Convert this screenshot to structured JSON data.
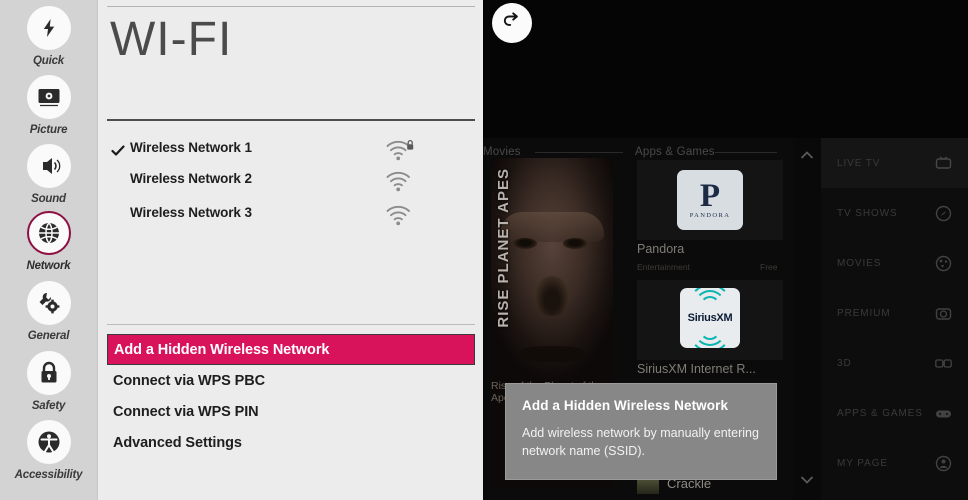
{
  "tv": {
    "back_button": {
      "icon": "back-arrow-icon"
    },
    "movies": {
      "heading": "Movies",
      "poster_title": "RISE PLANET APES",
      "poster_caption": "Rise of the Planet of the Apes"
    },
    "apps": {
      "heading": "Apps & Games",
      "items": [
        {
          "name": "Pandora",
          "logo_letter": "P",
          "logo_word": "PANDORA",
          "category": "Entertainment",
          "price": "Free"
        },
        {
          "name": "SiriusXM Internet R...",
          "logo_word": "SiriusXM",
          "category": "",
          "price": ""
        },
        {
          "name": "Crackle",
          "category": "",
          "price": ""
        }
      ],
      "scroll_up_icon": "chevron-up-icon",
      "scroll_down_icon": "chevron-down-icon"
    },
    "menu": [
      {
        "label": "LIVE TV",
        "icon": "tv-icon"
      },
      {
        "label": "TV SHOWS",
        "icon": "compass-icon"
      },
      {
        "label": "MOVIES",
        "icon": "film-reel-icon"
      },
      {
        "label": "PREMIUM",
        "icon": "camera-icon"
      },
      {
        "label": "3D",
        "icon": "glasses-3d-icon"
      },
      {
        "label": "APPS & GAMES",
        "icon": "gamepad-icon"
      },
      {
        "label": "MY PAGE",
        "icon": "person-icon"
      }
    ]
  },
  "tooltip": {
    "title": "Add a Hidden Wireless Network",
    "body": "Add wireless network by manually entering network name (SSID)."
  },
  "settings": {
    "sidebar": {
      "items": [
        {
          "label": "Quick",
          "icon": "lightning-bolt-icon",
          "active": false
        },
        {
          "label": "Picture",
          "icon": "picture-screen-icon",
          "active": false
        },
        {
          "label": "Sound",
          "icon": "sound-speaker-icon",
          "active": false
        },
        {
          "label": "Network",
          "icon": "globe-network-icon",
          "active": true
        },
        {
          "label": "General",
          "icon": "wrench-gear-icon",
          "active": false
        },
        {
          "label": "Safety",
          "icon": "padlock-icon",
          "active": false
        },
        {
          "label": "Accessibility",
          "icon": "accessibility-icon",
          "active": false
        }
      ]
    },
    "panel": {
      "title": "WI-FI",
      "networks": [
        {
          "name": "Wireless Network 1",
          "connected": true,
          "secured": true,
          "icon": "wifi-lock-icon"
        },
        {
          "name": "Wireless Network 2",
          "connected": false,
          "secured": false,
          "icon": "wifi-icon"
        },
        {
          "name": "Wireless Network 3",
          "connected": false,
          "secured": false,
          "icon": "wifi-icon"
        }
      ],
      "options": [
        {
          "label": "Add a Hidden Wireless Network",
          "selected": true
        },
        {
          "label": "Connect via WPS PBC",
          "selected": false
        },
        {
          "label": "Connect via WPS PIN",
          "selected": false
        },
        {
          "label": "Advanced Settings",
          "selected": false
        }
      ]
    }
  },
  "colors": {
    "accent": "#d9135b",
    "accent_ring": "#8d1042",
    "sidebar_bg": "#d3d3d3",
    "panel_bg": "#ececec",
    "tooltip_bg": "#878787"
  }
}
